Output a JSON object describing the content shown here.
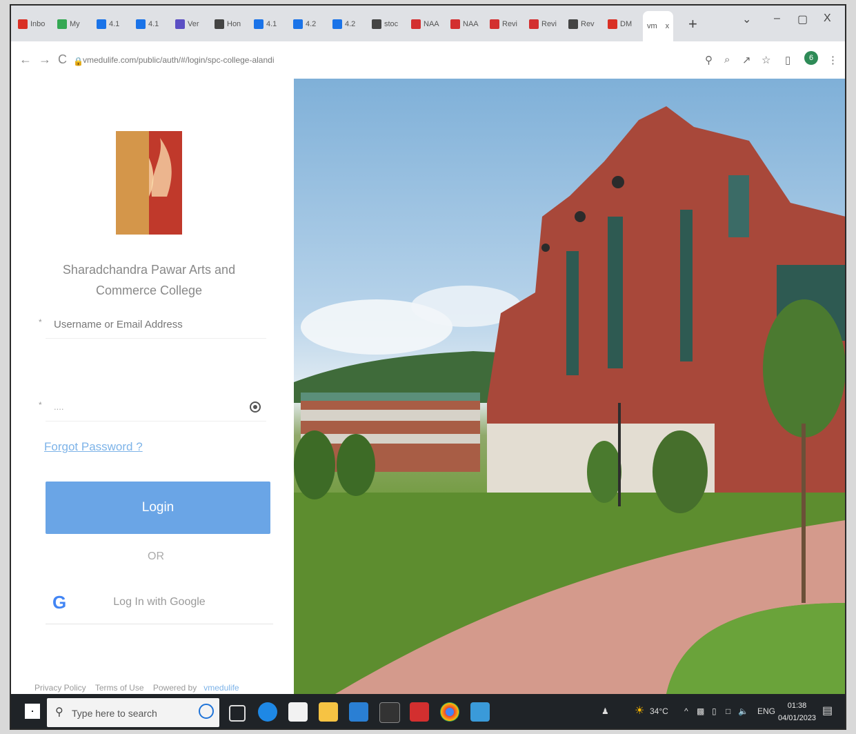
{
  "browser": {
    "tabs": [
      {
        "label": "Inbo",
        "color": "#d93025"
      },
      {
        "label": "My",
        "color": "#34a853"
      },
      {
        "label": "4.1",
        "color": "#1a73e8"
      },
      {
        "label": "4.1",
        "color": "#1a73e8"
      },
      {
        "label": "Ver",
        "color": "#5b4fc4"
      },
      {
        "label": "Hon",
        "color": "#444444"
      },
      {
        "label": "4.1",
        "color": "#1a73e8"
      },
      {
        "label": "4.2",
        "color": "#1a73e8"
      },
      {
        "label": "4.2",
        "color": "#1a73e8"
      },
      {
        "label": "stoc",
        "color": "#444444"
      },
      {
        "label": "NAA",
        "color": "#d32f2f"
      },
      {
        "label": "NAA",
        "color": "#d32f2f"
      },
      {
        "label": "Revi",
        "color": "#d32f2f"
      },
      {
        "label": "Revi",
        "color": "#d32f2f"
      },
      {
        "label": "Rev",
        "color": "#444444"
      },
      {
        "label": "DM",
        "color": "#d93025"
      }
    ],
    "active_tab": {
      "label": "vm",
      "close": "x"
    },
    "new_tab": "+",
    "window_controls": {
      "chevron": "⌄",
      "minimize": "–",
      "maximize": "▢",
      "close": "X"
    },
    "nav": {
      "back": "←",
      "forward": "→",
      "reload": "C"
    },
    "url": "vmedulife.com/public/auth/#/login/spc-college-alandi",
    "profile_initial": "6"
  },
  "login": {
    "college_name": "Sharadchandra Pawar Arts and Commerce College",
    "username_placeholder": "Username or Email Address",
    "password_value": "....",
    "required_mark": "*",
    "forgot": "Forgot Password ?",
    "login_button": "Login",
    "or": "OR",
    "google_button": "Log In with Google",
    "footer": {
      "privacy": "Privacy Policy",
      "terms": "Terms of Use",
      "powered": "Powered by",
      "brand": "vmedulife"
    }
  },
  "taskbar": {
    "search_placeholder": "Type here to search",
    "weather": "34°C",
    "language": "ENG",
    "time": "01:38",
    "date": "04/01/2023"
  }
}
